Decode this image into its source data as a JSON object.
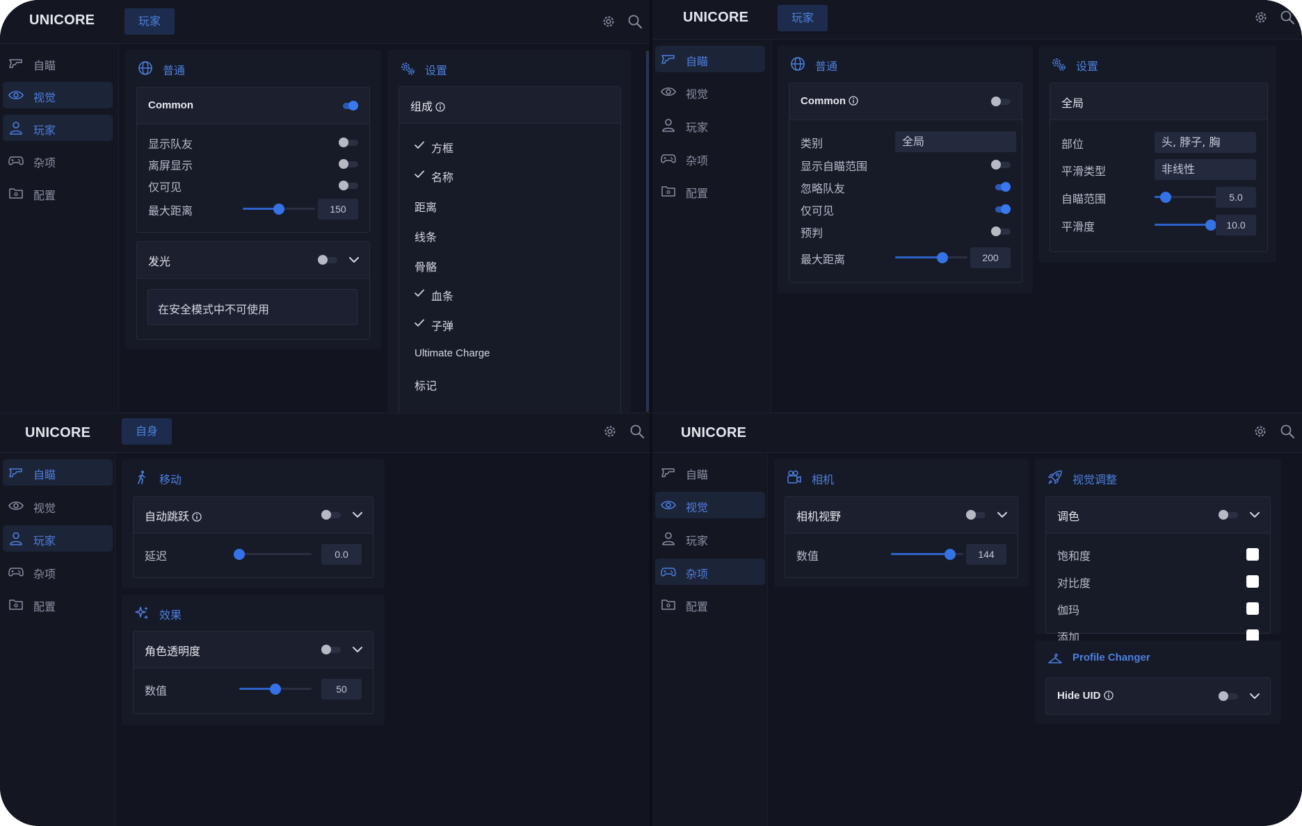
{
  "app": {
    "logo": "UNICORE"
  },
  "q1": {
    "tab": "玩家",
    "nav": [
      "自瞄",
      "视觉",
      "玩家",
      "杂项",
      "配置"
    ],
    "panel_normal": {
      "title": "普通",
      "card_title": "Common",
      "rows": [
        "显示队友",
        "离屏显示",
        "仅可见"
      ],
      "max_dist_label": "最大距离",
      "max_dist_value": "150",
      "max_dist_level": 0.5
    },
    "glow": {
      "title": "发光",
      "note": "在安全模式中不可使用"
    },
    "panel_settings": {
      "title": "设置",
      "card_title": "组成",
      "items": [
        {
          "label": "方框",
          "checked": true
        },
        {
          "label": "名称",
          "checked": true
        },
        {
          "label": "距离",
          "checked": false
        },
        {
          "label": "线条",
          "checked": false
        },
        {
          "label": "骨骼",
          "checked": false
        },
        {
          "label": "血条",
          "checked": true
        },
        {
          "label": "子弹",
          "checked": true
        },
        {
          "label": "Ultimate Charge",
          "checked": false
        },
        {
          "label": "标记",
          "checked": false
        }
      ]
    }
  },
  "q2": {
    "tab": "玩家",
    "nav": [
      "自瞄",
      "视觉",
      "玩家",
      "杂项",
      "配置"
    ],
    "panel_normal": {
      "title": "普通",
      "card_title": "Common",
      "category_label": "类别",
      "category_value": "全局",
      "rows": [
        "显示自瞄范围",
        "忽略队友",
        "仅可见",
        "预判"
      ],
      "max_dist_label": "最大距离",
      "max_dist_value": "200",
      "max_dist_level": 0.65
    },
    "panel_settings": {
      "title": "设置",
      "card_title": "全局",
      "part_label": "部位",
      "part_value": "头, 脖子, 胸",
      "smooth_type_label": "平滑类型",
      "smooth_type_value": "非线性",
      "aim_range_label": "自瞄范围",
      "aim_range_value": "5.0",
      "aim_range_level": 0.15,
      "smooth_label": "平滑度",
      "smooth_value": "10.0",
      "smooth_level": 0.78
    }
  },
  "q3": {
    "tab": "自身",
    "nav": [
      "自瞄",
      "视觉",
      "玩家",
      "杂项",
      "配置"
    ],
    "panel_move": {
      "title": "移动",
      "card_title": "自动跳跃",
      "delay_label": "延迟",
      "delay_value": "0.0",
      "delay_level": 0.0
    },
    "panel_effect": {
      "title": "效果",
      "card_title": "角色透明度",
      "value_label": "数值",
      "value": "50",
      "value_level": 0.5
    }
  },
  "q4": {
    "nav": [
      "自瞄",
      "视觉",
      "玩家",
      "杂项",
      "配置"
    ],
    "panel_camera": {
      "title": "相机",
      "card_title": "相机视野",
      "value_label": "数值",
      "value": "144",
      "value_level": 0.82
    },
    "panel_visual": {
      "title": "视觉调整",
      "card_title": "调色",
      "rows": [
        "饱和度",
        "对比度",
        "伽玛",
        "添加"
      ]
    },
    "panel_profile": {
      "title": "Profile Changer",
      "card_title": "Hide UID"
    }
  },
  "colors": {
    "accent": "#3a78f0",
    "background": "#131621",
    "panel": "#161a27"
  }
}
